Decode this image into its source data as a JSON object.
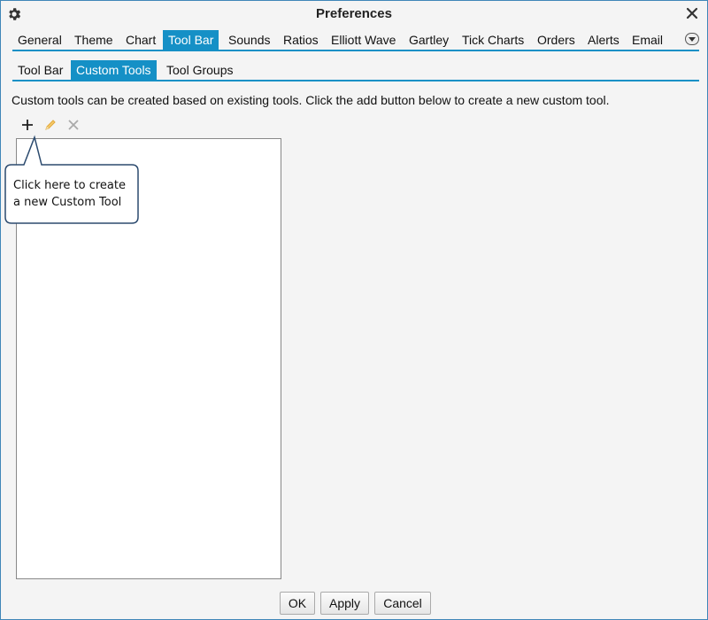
{
  "window": {
    "title": "Preferences",
    "accent_color": "#1590c6",
    "border_color": "#3f86b8"
  },
  "tabs": [
    {
      "label": "General",
      "active": false
    },
    {
      "label": "Theme",
      "active": false
    },
    {
      "label": "Chart",
      "active": false
    },
    {
      "label": "Tool Bar",
      "active": true
    },
    {
      "label": "Sounds",
      "active": false
    },
    {
      "label": "Ratios",
      "active": false
    },
    {
      "label": "Elliott Wave",
      "active": false
    },
    {
      "label": "Gartley",
      "active": false
    },
    {
      "label": "Tick Charts",
      "active": false
    },
    {
      "label": "Orders",
      "active": false
    },
    {
      "label": "Alerts",
      "active": false
    },
    {
      "label": "Email",
      "active": false
    }
  ],
  "subtabs": [
    {
      "label": "Tool Bar",
      "active": false
    },
    {
      "label": "Custom Tools",
      "active": true
    },
    {
      "label": "Tool Groups",
      "active": false
    }
  ],
  "description": "Custom tools can be created based on existing tools.  Click the add button below to create a new custom tool.",
  "toolbar": {
    "add_icon": "plus-icon",
    "edit_icon": "pencil-icon",
    "delete_icon": "x-icon"
  },
  "callout": {
    "line1": "Click here to create",
    "line2": "a new Custom Tool"
  },
  "buttons": {
    "ok": "OK",
    "apply": "Apply",
    "cancel": "Cancel"
  }
}
